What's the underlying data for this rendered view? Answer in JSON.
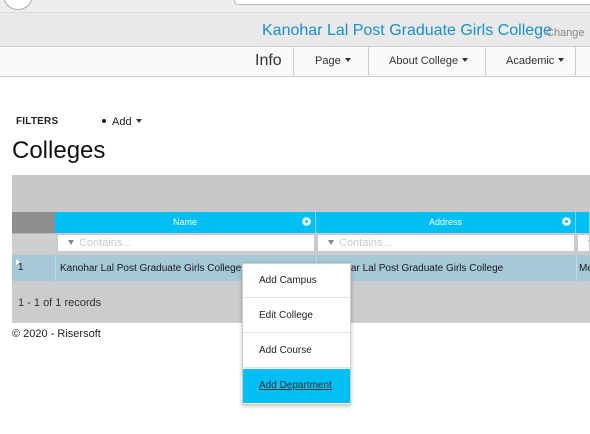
{
  "header": {
    "college_name": "Kanohar Lal Post Graduate Girls College",
    "change_label": "Change"
  },
  "nav": {
    "info_label": "Info",
    "items": [
      {
        "label": "Page"
      },
      {
        "label": "About College"
      },
      {
        "label": "Academic"
      }
    ]
  },
  "toolbar": {
    "filters_label": "FILTERS",
    "add_label": "Add"
  },
  "page": {
    "title": "Colleges"
  },
  "grid": {
    "columns": [
      {
        "label": "Name"
      },
      {
        "label": "Address"
      }
    ],
    "filter_placeholder": "Contains...",
    "rows": [
      {
        "index": "1",
        "name": "Kanohar Lal Post Graduate Girls College",
        "address": "Kanohar Lal Post Graduate Girls College",
        "extra": "Me"
      }
    ],
    "records_text": "1 - 1 of 1 records"
  },
  "context_menu": {
    "items": [
      {
        "label": "Add Campus"
      },
      {
        "label": "Edit College"
      },
      {
        "label": "Add Course"
      },
      {
        "label": "Add Department"
      }
    ],
    "active_item": "Add Department"
  },
  "footer": {
    "copyright": "© 2020 - Risersoft"
  },
  "colors": {
    "accent": "#00bff5",
    "brand_text": "#1a8fc9",
    "selected_row": "#a5c9d6",
    "grid_bg": "#cccccc"
  },
  "icons": [
    "dropdown-caret-icon",
    "filter-funnel-icon",
    "column-settings-gear-icon",
    "row-expand-arrow-icon"
  ]
}
